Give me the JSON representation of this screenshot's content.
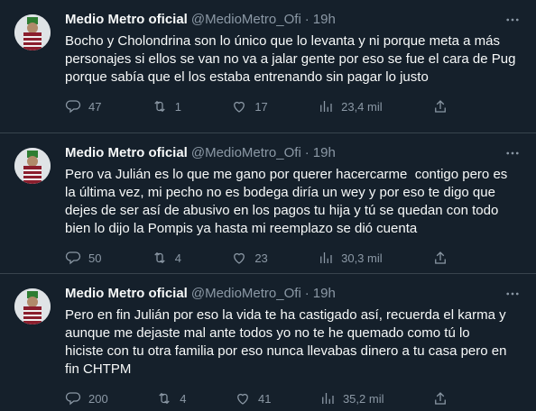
{
  "tweets": [
    {
      "name": "Medio Metro oficial",
      "handle": "@MedioMetro_Ofi",
      "time": "19h",
      "text": "Bocho y Cholondrina son lo único que lo levanta y ni porque meta a más\npersonajes si ellos se van no va a jalar gente por eso se fue el cara de Pug\nporque sabía que el los estaba entrenando sin pagar lo justo",
      "replies": "47",
      "retweets": "1",
      "likes": "17",
      "views": "23,4 mil"
    },
    {
      "name": "Medio Metro oficial",
      "handle": "@MedioMetro_Ofi",
      "time": "19h",
      "text": "Pero va Julián es lo que me gano por querer hacercarme  contigo pero es\nla última vez, mi pecho no es bodega diría un wey y por eso te digo que\ndejes de ser así de abusivo en los pagos tu hija y tú se quedan con todo\nbien lo dijo la Pompis ya hasta mi reemplazo se dió cuenta",
      "replies": "50",
      "retweets": "4",
      "likes": "23",
      "views": "30,3 mil"
    },
    {
      "name": "Medio Metro oficial",
      "handle": "@MedioMetro_Ofi",
      "time": "19h",
      "text": "Pero en fin Julián por eso la vida te ha castigado así, recuerda el karma y\naunque me dejaste mal ante todos yo no te he quemado como tú lo\nhiciste con tu otra familia por eso nunca llevabas dinero a tu casa pero en\nfin CHTPM",
      "replies": "200",
      "retweets": "4",
      "likes": "41",
      "views": "35,2 mil"
    }
  ],
  "icons": {
    "reply": "reply-icon",
    "retweet": "retweet-icon",
    "like": "heart-icon",
    "views": "views-icon",
    "share": "share-icon",
    "more": "more-icon"
  },
  "colors": {
    "background": "#15202b",
    "text": "#f7f9f9",
    "muted": "#8b98a5",
    "divider": "#38444d"
  }
}
